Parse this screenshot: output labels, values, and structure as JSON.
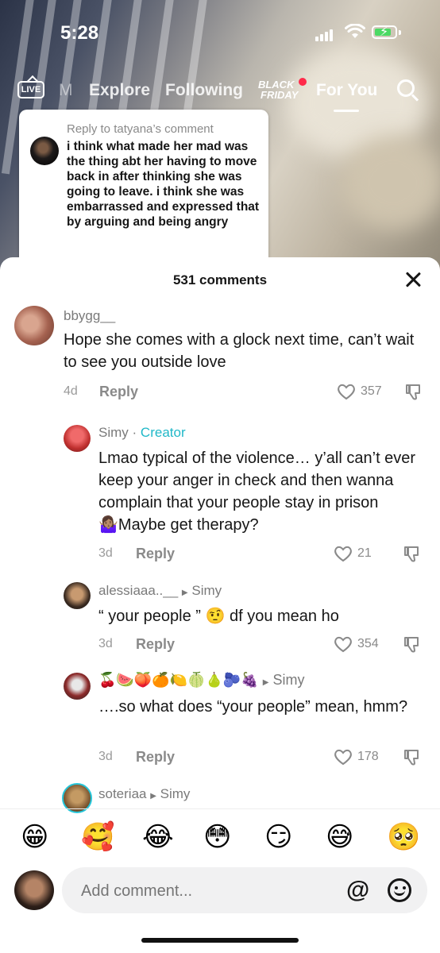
{
  "status_bar": {
    "time": "5:28"
  },
  "top_nav": {
    "live": "LIVE",
    "partial_tab": "M",
    "explore": "Explore",
    "following": "Following",
    "black_friday": [
      "BLACK",
      "FRIDAY"
    ],
    "for_you": "For You"
  },
  "reply_card": {
    "header": "Reply to tatyana’s comment",
    "text": "i think what made her mad was the thing abt her having to move back in after thinking she was going to leave. i think she was embarrassed and expressed that by arguing and being angry"
  },
  "comments_sheet": {
    "title": "531 comments",
    "comments": [
      {
        "user": "bbygg__",
        "text": "Hope she comes with a glock next time, can’t wait to see you outside love",
        "age": "4d",
        "reply": "Reply",
        "likes": "357"
      },
      {
        "user": "Simy",
        "separator": "·",
        "badge": "Creator",
        "text": "Lmao typical of the violence… y’all can’t ever keep your anger in check and then wanna complain that your people stay in prison 🤷🏽‍♀️Maybe get therapy?",
        "age": "3d",
        "reply": "Reply",
        "likes": "21"
      },
      {
        "user": "alessiaaa..__",
        "reply_to": "Simy",
        "text": "“ your people ” 🤨 df you mean ho",
        "age": "3d",
        "reply": "Reply",
        "likes": "354"
      },
      {
        "user": "🍒🍉🍑🍊🍋🍈🍐🫐🍇",
        "reply_to": "Simy",
        "text": "….so what does “your people” mean, hmm?",
        "age": "3d",
        "reply": "Reply",
        "likes": "178"
      },
      {
        "user": "soteriaa",
        "reply_to": "Simy"
      }
    ]
  },
  "emoji_bar": [
    "😁",
    "🥰",
    "😂",
    "😳",
    "😏",
    "😅",
    "🥺"
  ],
  "composer": {
    "placeholder": "Add comment...",
    "at": "@"
  }
}
